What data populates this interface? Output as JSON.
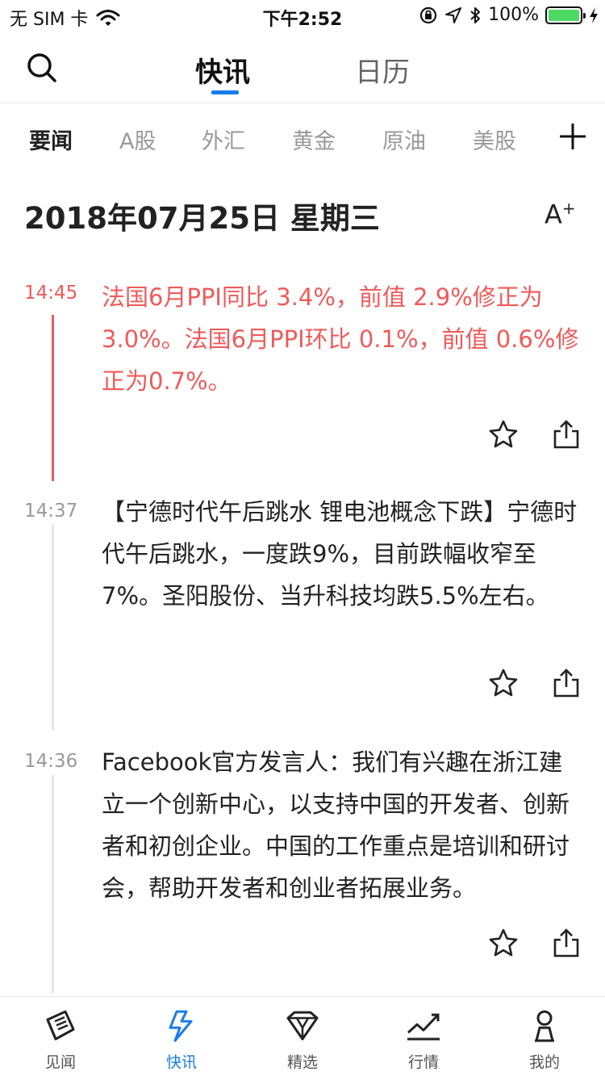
{
  "status_bar": {
    "carrier": "无 SIM 卡",
    "time": "下午2:52",
    "battery": "100%"
  },
  "top_nav": {
    "tabs": [
      {
        "label": "快讯",
        "active": true
      },
      {
        "label": "日历",
        "active": false
      }
    ],
    "accent_color": "#1a7bea"
  },
  "categories": [
    {
      "label": "要闻",
      "active": true
    },
    {
      "label": "A股",
      "active": false
    },
    {
      "label": "外汇",
      "active": false
    },
    {
      "label": "黄金",
      "active": false
    },
    {
      "label": "原油",
      "active": false
    },
    {
      "label": "美股",
      "active": false
    }
  ],
  "date_header": {
    "title": "2018年07月25日 星期三",
    "font_button": "A",
    "font_button_sup": "+"
  },
  "feed": [
    {
      "time": "14:45",
      "text": "法国6月PPI同比 3.4%，前值 2.9%修正为3.0%。法国6月PPI环比 0.1%，前值 0.6%修正为0.7%。",
      "highlight": true,
      "highlight_color": "#ef5a5a"
    },
    {
      "time": "14:37",
      "text": "【宁德时代午后跳水 锂电池概念下跌】宁德时代午后跳水，一度跌9%，目前跌幅收窄至7%。圣阳股份、当升科技均跌5.5%左右。",
      "highlight": false
    },
    {
      "time": "14:36",
      "text": "Facebook官方发言人：我们有兴趣在浙江建立一个创新中心，以支持中国的开发者、创新者和初创企业。中国的工作重点是培训和研讨会，帮助开发者和创业者拓展业务。",
      "highlight": false
    }
  ],
  "tab_bar": [
    {
      "label": "见闻",
      "icon": "news-paper-icon",
      "active": false
    },
    {
      "label": "快讯",
      "icon": "lightning-icon",
      "active": true
    },
    {
      "label": "精选",
      "icon": "gem-icon",
      "active": false
    },
    {
      "label": "行情",
      "icon": "chart-line-icon",
      "active": false
    },
    {
      "label": "我的",
      "icon": "profile-icon",
      "active": false
    }
  ]
}
